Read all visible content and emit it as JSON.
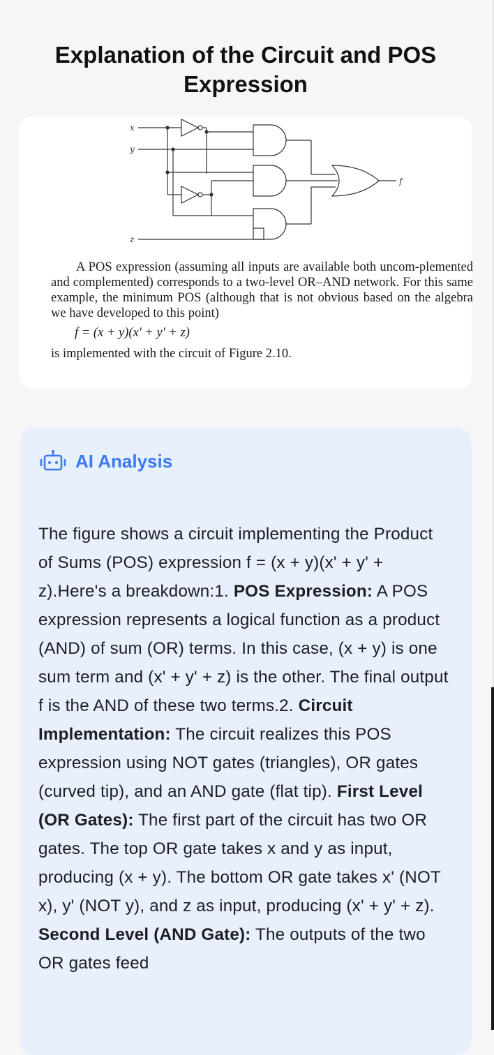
{
  "page": {
    "title": "Explanation of the Circuit and POS Expression"
  },
  "figure": {
    "labels": {
      "x": "x",
      "y": "y",
      "z": "z",
      "f": "f"
    },
    "paragraph1": "A POS expression (assuming all inputs are available both uncom-plemented and complemented) corresponds to a two-level OR–AND network. For this same example, the minimum POS (although that is not obvious based on the algebra we have developed to this point)",
    "formula": "f = (x + y)(x′ + y′ + z)",
    "paragraph2": "is implemented with the circuit of Figure 2.10."
  },
  "ai": {
    "icon": "robot-icon",
    "accent_color": "#3a7bf3",
    "title": "AI Analysis",
    "segments": [
      {
        "bold": false,
        "text": "The figure shows a circuit implementing the Product of Sums (POS) expression f = (x + y)(x' + y' + z).Here's a breakdown:1. "
      },
      {
        "bold": true,
        "text": "POS Expression:"
      },
      {
        "bold": false,
        "text": " A POS expression represents a logical function as a product (AND) of sum (OR) terms.  In this case, (x + y) is one sum term and (x' + y' + z) is the other. The final output f is the AND of these two terms.2. "
      },
      {
        "bold": true,
        "text": "Circuit Implementation:"
      },
      {
        "bold": false,
        "text": " The circuit realizes this POS expression using NOT gates (triangles), OR gates (curved tip), and an AND gate (flat tip).    "
      },
      {
        "bold": true,
        "text": "First Level (OR Gates):"
      },
      {
        "bold": false,
        "text": " The first part of the circuit has two OR gates.       The top OR gate takes x and y as input, producing (x + y).       The bottom OR gate takes x' (NOT x), y' (NOT y), and z as input, producing (x' + y' + z).    "
      },
      {
        "bold": true,
        "text": "Second Level (AND Gate):"
      },
      {
        "bold": false,
        "text": " The outputs of the two OR gates feed"
      }
    ]
  }
}
